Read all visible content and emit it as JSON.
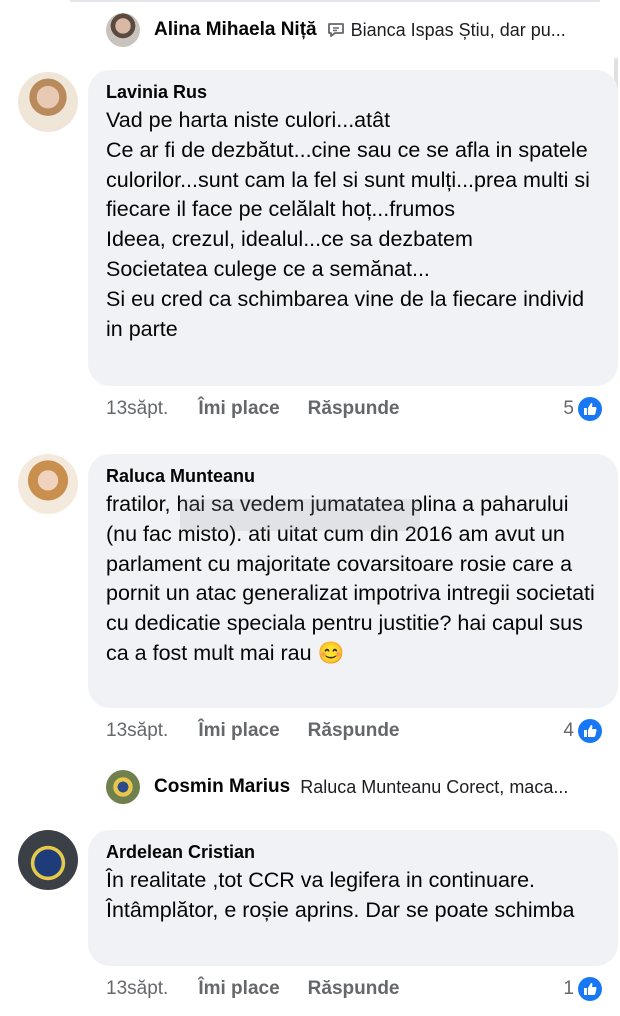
{
  "reply_top": {
    "name": "Alina Mihaela Niță",
    "text": "Bianca Ispas Știu, dar pu..."
  },
  "comments": [
    {
      "author": "Lavinia Rus",
      "text": "Vad pe harta niste culori...atât\nCe ar fi de dezbătut...cine sau ce se afla in spatele culorilor...sunt cam la fel si sunt mulți...prea multi si fiecare il face pe celălalt hoț...frumos\nIdeea, crezul, idealul...ce sa dezbatem\nSocietatea culege ce a semănat...\nSi eu cred ca schimbarea vine de la fiecare individ in parte",
      "time": "13săpt.",
      "like": "Îmi place",
      "reply": "Răspunde",
      "reactions": "5"
    },
    {
      "author": "Raluca Munteanu",
      "text": "fratilor, hai sa vedem jumatatea plina a paharului (nu fac misto). ati uitat cum din 2016 am avut un parlament cu majoritate covarsitoare rosie care a pornit un atac generalizat impotriva intregii societati cu dedicatie speciala pentru justitie? hai capul sus ca a fost mult mai rau 😊",
      "time": "13săpt.",
      "like": "Îmi place",
      "reply": "Răspunde",
      "reactions": "4"
    },
    {
      "author": "Ardelean Cristian",
      "text": "În realitate ,tot CCR va legifera in continuare.\nÎntâmplător, e roșie aprins. Dar se poate schimba",
      "time": "13săpt.",
      "like": "Îmi place",
      "reply": "Răspunde",
      "reactions": "1"
    }
  ],
  "reply_middle": {
    "name": "Cosmin Marius",
    "text": "Raluca Munteanu Corect, maca..."
  },
  "colors": {
    "bubble": "#f0f2f5",
    "like_blue": "#1877f2",
    "meta_gray": "#65676b"
  }
}
